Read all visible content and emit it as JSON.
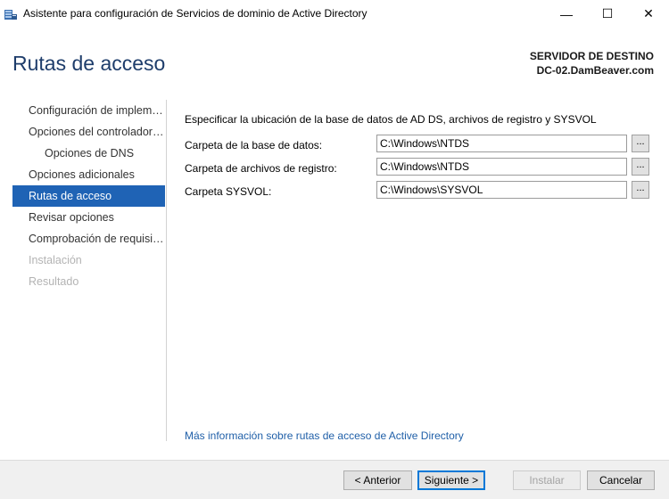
{
  "window": {
    "title": "Asistente para configuración de Servicios de dominio de Active Directory",
    "minimize": "—",
    "maximize": "☐",
    "close": "✕",
    "icon": "ad-wizard-icon"
  },
  "header": {
    "page_title": "Rutas de acceso",
    "server_heading": "SERVIDOR DE DESTINO",
    "server_name": "DC-02.DamBeaver.com"
  },
  "nav": {
    "items": [
      {
        "label": "Configuración de implementación",
        "state": "normal"
      },
      {
        "label": "Opciones del controlador de dominio",
        "state": "normal"
      },
      {
        "label": "Opciones de DNS",
        "state": "sub"
      },
      {
        "label": "Opciones adicionales",
        "state": "normal"
      },
      {
        "label": "Rutas de acceso",
        "state": "active"
      },
      {
        "label": "Revisar opciones",
        "state": "normal"
      },
      {
        "label": "Comprobación de requisitos previos",
        "state": "normal"
      },
      {
        "label": "Instalación",
        "state": "disabled"
      },
      {
        "label": "Resultado",
        "state": "disabled"
      }
    ]
  },
  "main": {
    "intro": "Especificar la ubicación de la base de datos de AD DS, archivos de registro y SYSVOL",
    "fields": [
      {
        "label": "Carpeta de la base de datos:",
        "value": "C:\\Windows\\NTDS",
        "browse": "..."
      },
      {
        "label": "Carpeta de archivos de registro:",
        "value": "C:\\Windows\\NTDS",
        "browse": "..."
      },
      {
        "label": "Carpeta SYSVOL:",
        "value": "C:\\Windows\\SYSVOL",
        "browse": "..."
      }
    ],
    "more_info_link": "Más información sobre rutas de acceso de Active Directory"
  },
  "footer": {
    "back": "< Anterior",
    "next": "Siguiente >",
    "install": "Instalar",
    "cancel": "Cancelar"
  },
  "colors": {
    "accent": "#1f63b5",
    "title_blue": "#1e3d6b",
    "link": "#1f5fa8"
  }
}
